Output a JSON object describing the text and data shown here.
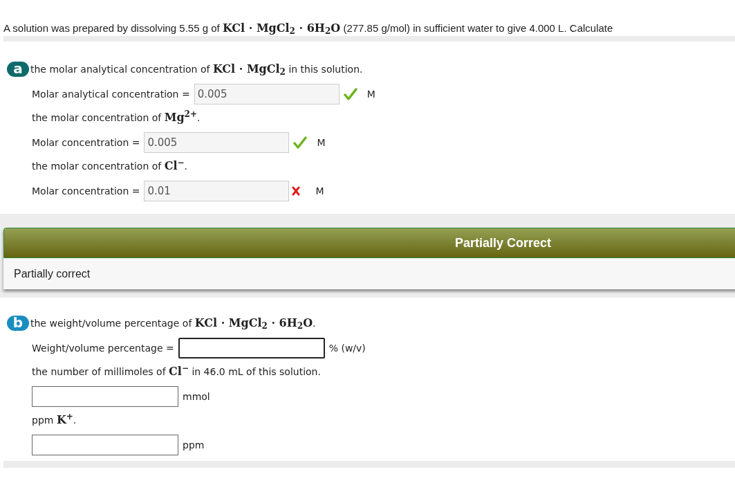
{
  "question": {
    "before": "A solution was prepared by dissolving 5.55 g of",
    "formula": "KCl · MgCl$_{2}$ · 6H$_{2}$O",
    "after": "(277.85 g/mol) in sufficient water to give 4.000 L. Calculate"
  },
  "parts": [
    {
      "letter": "a",
      "color": "#0f6b6b",
      "items": [
        {
          "kind": "prompt",
          "before": "the molar analytical concentration of",
          "formula": "KCl · MgCl$_{2}$",
          "after": "in this solution."
        },
        {
          "kind": "field",
          "label": "Molar analytical concentration =",
          "value": "0.005",
          "disabled": true,
          "correct": true,
          "unit": "M"
        },
        {
          "kind": "prompt",
          "before": "the molar concentration of",
          "formula": "Mg$^{2+}$",
          "after": "."
        },
        {
          "kind": "field",
          "label": "Molar concentration =",
          "value": "0.005",
          "disabled": true,
          "correct": true,
          "unit": "M"
        },
        {
          "kind": "prompt",
          "before": "the molar concentration of",
          "formula": "Cl$^{−}$",
          "after": "."
        },
        {
          "kind": "field",
          "label": "Molar concentration =",
          "value": "0.01",
          "disabled": true,
          "correct": false,
          "unit": "M"
        }
      ],
      "feedback": {
        "title": "Partially Correct",
        "message": "Partially correct"
      }
    },
    {
      "letter": "b",
      "color": "#1a8ec1",
      "items": [
        {
          "kind": "prompt",
          "before": "the weight/volume percentage of",
          "formula": "KCl · MgCl$_{2}$ · 6H$_{2}$O",
          "after": "."
        },
        {
          "kind": "field",
          "label": "Weight/volume percentage =",
          "disabled": false,
          "unit": "% (w/v)"
        },
        {
          "kind": "prompt",
          "before": "the number of millimoles of",
          "formula": "Cl$^{−}$",
          "after": "in 46.0 mL of this solution."
        },
        {
          "kind": "field",
          "disabled": false,
          "unit": "mmol"
        },
        {
          "kind": "prompt",
          "before": "ppm",
          "formula": "K$^{+}$",
          "after": "."
        },
        {
          "kind": "field",
          "disabled": false,
          "unit": "ppm"
        }
      ]
    }
  ]
}
